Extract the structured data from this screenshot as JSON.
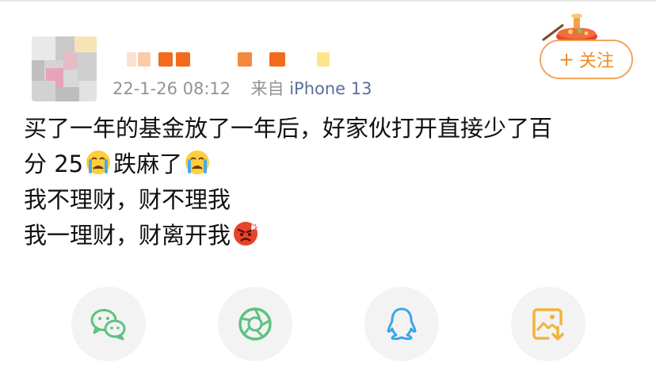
{
  "post": {
    "timestamp": "22-1-26 08:12",
    "source_prefix": "来自",
    "source_device": "iPhone 13",
    "line1": "买了一年的基金放了一年后，好家伙打开直接少了百",
    "line2_text_a": "分 25",
    "line2_text_b": "跌麻了",
    "line3": "我不理财，财不理我",
    "line4": "我一理财，财离开我",
    "emoji": {
      "crying": "crying-face-icon",
      "angry": "angry-face-icon"
    }
  },
  "follow": {
    "plus": "+",
    "label": "关注"
  },
  "share": [
    {
      "icon": "wechat-icon",
      "color": "#5dc280"
    },
    {
      "icon": "moments-icon",
      "color": "#5dc280"
    },
    {
      "icon": "qq-icon",
      "color": "#3aa6e8"
    },
    {
      "icon": "save-image-icon",
      "color": "#f1b43a"
    }
  ],
  "colors": {
    "accent": "#f08a2b",
    "meta": "#939393",
    "source": "#5b6f9a"
  }
}
